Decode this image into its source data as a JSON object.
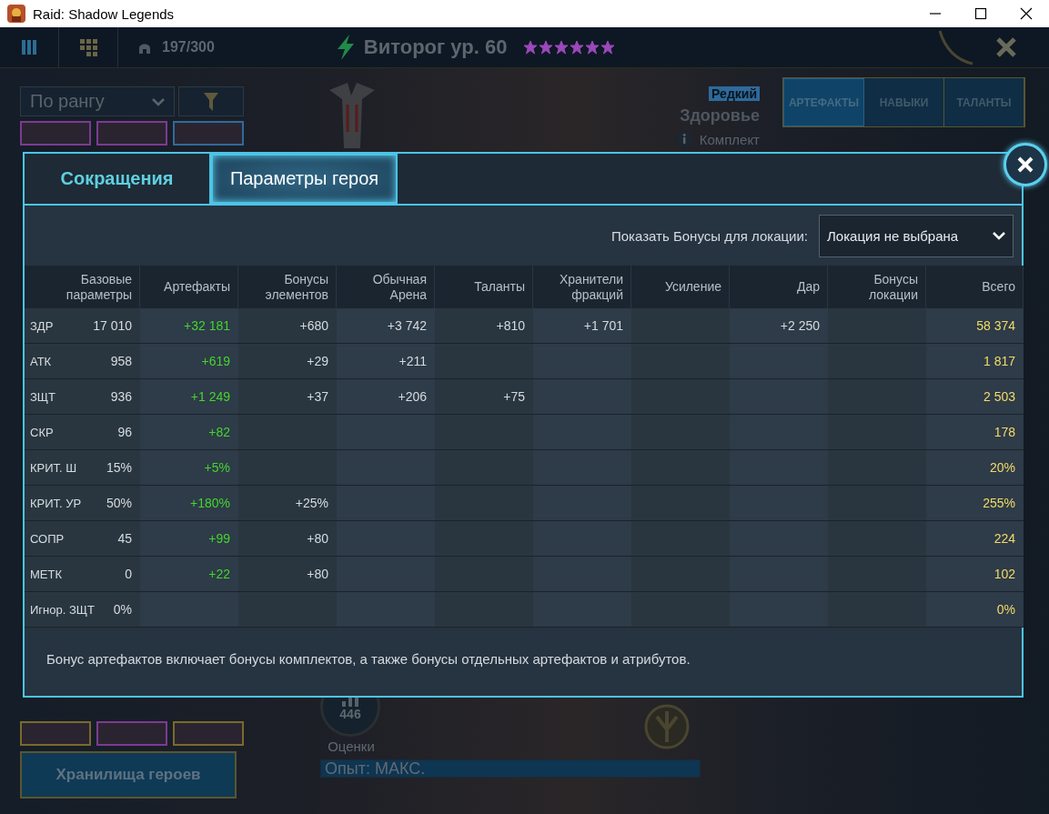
{
  "window": {
    "title": "Raid: Shadow Legends"
  },
  "top_bar": {
    "hero_count": "197/300",
    "hero_name": "Виторог ур. 60",
    "stars": 6
  },
  "hero_panel": {
    "sort": "По рангу",
    "cards": [
      {
        "color": "#7d3a92"
      },
      {
        "color": "#7d3a92"
      },
      {
        "color": "#2f6a9a"
      }
    ],
    "bottom_cards": [
      {
        "color": "#7a6a2a"
      },
      {
        "color": "#7d3a92"
      },
      {
        "color": "#7a6a2a"
      }
    ],
    "rarity": "Редкий",
    "stat_focus": "Здоровье",
    "set_label": "Комплект",
    "tabs": [
      {
        "label": "АРТЕФАКТЫ",
        "selected": true
      },
      {
        "label": "НАВЫКИ",
        "selected": false
      },
      {
        "label": "ТАЛАНТЫ",
        "selected": false
      }
    ],
    "rating": "446",
    "rating_label": "Оценки",
    "experience": "Опыт: МАКС.",
    "vault_button": "Хранилища героев"
  },
  "dialog": {
    "tabs": [
      {
        "label": "Сокращения",
        "selected": false
      },
      {
        "label": "Параметры героя",
        "selected": true
      }
    ],
    "location_label": "Показать Бонусы для локации:",
    "location": "Локация не выбрана",
    "columns": [
      {
        "label": "Базовые параметры",
        "kind": "base"
      },
      {
        "label": "Артефакты",
        "kind": "artifact"
      },
      {
        "label": "Бонусы элементов",
        "kind": "plain"
      },
      {
        "label": "Обычная Арена",
        "kind": "plain"
      },
      {
        "label": "Таланты",
        "kind": "plain"
      },
      {
        "label": "Хранители фракций",
        "kind": "plain"
      },
      {
        "label": "Усиление",
        "kind": "plain"
      },
      {
        "label": "Дар",
        "kind": "plain"
      },
      {
        "label": "Бонусы локации",
        "kind": "plain"
      },
      {
        "label": "Всего",
        "kind": "total"
      }
    ],
    "rows": [
      {
        "stat": "ЗДР",
        "cells": [
          "17 010",
          "+32 181",
          "+680",
          "+3 742",
          "+810",
          "+1 701",
          null,
          "+2 250",
          null,
          "58 374"
        ]
      },
      {
        "stat": "АТК",
        "cells": [
          "958",
          "+619",
          "+29",
          "+211",
          null,
          null,
          null,
          null,
          null,
          "1 817"
        ]
      },
      {
        "stat": "ЗЩТ",
        "cells": [
          "936",
          "+1 249",
          "+37",
          "+206",
          "+75",
          null,
          null,
          null,
          null,
          "2 503"
        ]
      },
      {
        "stat": "СКР",
        "cells": [
          "96",
          "+82",
          null,
          null,
          null,
          null,
          null,
          null,
          null,
          "178"
        ]
      },
      {
        "stat": "КРИТ. Ш",
        "cells": [
          "15%",
          "+5%",
          null,
          null,
          null,
          null,
          null,
          null,
          null,
          "20%"
        ]
      },
      {
        "stat": "КРИТ. УР",
        "cells": [
          "50%",
          "+180%",
          "+25%",
          null,
          null,
          null,
          null,
          null,
          null,
          "255%"
        ]
      },
      {
        "stat": "СОПР",
        "cells": [
          "45",
          "+99",
          "+80",
          null,
          null,
          null,
          null,
          null,
          null,
          "224"
        ]
      },
      {
        "stat": "МЕТК",
        "cells": [
          "0",
          "+22",
          "+80",
          null,
          null,
          null,
          null,
          null,
          null,
          "102"
        ]
      },
      {
        "stat": "Игнор. ЗЩТ",
        "cells": [
          "0%",
          null,
          null,
          null,
          null,
          null,
          null,
          null,
          null,
          "0%"
        ]
      }
    ],
    "note": "Бонус артефактов включает бонусы комплектов, а также бонусы отдельных артефактов и атрибутов."
  }
}
